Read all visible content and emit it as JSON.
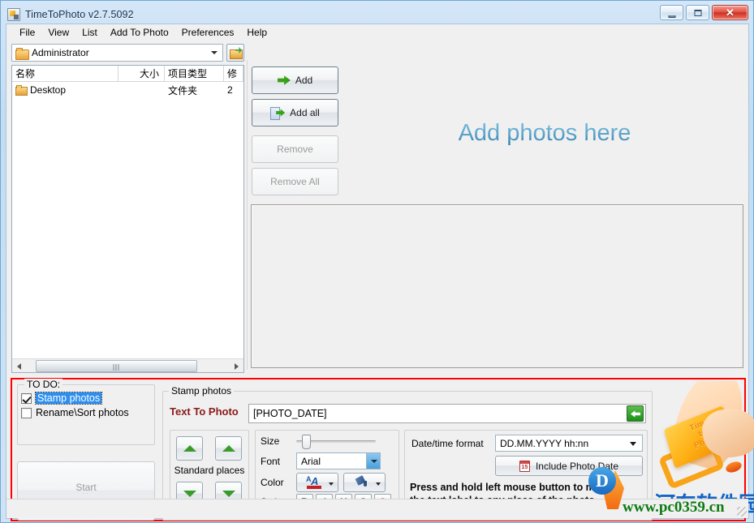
{
  "window": {
    "title": "TimeToPhoto v2.7.5092",
    "icon": "app-icon",
    "minimize_label": "",
    "maximize_label": "",
    "close_label": "✕"
  },
  "menu": {
    "items": [
      {
        "label": "File"
      },
      {
        "label": "View"
      },
      {
        "label": "List"
      },
      {
        "label": "Add To Photo"
      },
      {
        "label": "Preferences"
      },
      {
        "label": "Help"
      }
    ]
  },
  "browser": {
    "path_value": "Administrator",
    "browse_icon": "open-folder-icon",
    "dropdown_icon": "chevron-down-icon",
    "columns": [
      {
        "label": "名称"
      },
      {
        "label": "大小"
      },
      {
        "label": "项目类型"
      },
      {
        "label": "修"
      }
    ],
    "rows": [
      {
        "name": "Desktop",
        "size": "",
        "type": "文件夹",
        "extra": "2"
      }
    ],
    "scrollbar": {
      "left_icon": "arrow-left-icon",
      "right_icon": "arrow-right-icon"
    }
  },
  "actions": {
    "add": {
      "label": "Add",
      "icon": "green-arrow-right-icon",
      "enabled": true
    },
    "add_all": {
      "label": "Add all",
      "icon": "add-all-icon",
      "enabled": true
    },
    "remove": {
      "label": "Remove",
      "enabled": false
    },
    "remove_all": {
      "label": "Remove All",
      "enabled": false
    }
  },
  "drop_area": {
    "text": "Add photos here"
  },
  "todo": {
    "legend": "TO DO:",
    "items": [
      {
        "label": "Stamp photos",
        "checked": true,
        "selected": true
      },
      {
        "label": "Rename\\Sort photos",
        "checked": false,
        "selected": false
      }
    ],
    "start_button": {
      "label": "Start",
      "sub": "˙˙",
      "enabled": false
    }
  },
  "stamp": {
    "legend": "Stamp photos",
    "text_to_photo_label": "Text To Photo",
    "text_value": "[PHOTO_DATE]",
    "revert_icon": "green-arrow-left-icon",
    "places": {
      "label": "Standard places",
      "up_left_icon": "arrow-up-icon",
      "up_right_icon": "arrow-up-icon",
      "down_left_icon": "arrow-down-icon",
      "down_right_icon": "arrow-down-icon"
    },
    "format": {
      "size_label": "Size",
      "size_value": 12,
      "font_label": "Font",
      "font_value": "Arial",
      "color_label": "Color",
      "font_color_icon": "font-color-icon",
      "fill_color_icon": "fill-color-icon",
      "style_label": "Style",
      "style_buttons": [
        {
          "label": "B",
          "name": "bold"
        },
        {
          "label": "I",
          "name": "italic"
        },
        {
          "label": "U",
          "name": "underline"
        },
        {
          "label": "S",
          "name": "shadow"
        },
        {
          "label": "O",
          "name": "outline"
        }
      ]
    },
    "date": {
      "format_label": "Date/time format",
      "format_value": "DD.MM.YYYY hh:nn",
      "include_button": "Include Photo Date",
      "calendar_icon": "calendar-icon",
      "hint_line1": "Press and hold left mouse button to move",
      "hint_line2": "the text label to any place of the photo"
    }
  },
  "watermark": {
    "stamp_text_line1": "Time",
    "stamp_text_line2": "to",
    "stamp_text_line3": "Photo",
    "site_cn": "河东软件园",
    "site_url": "www.pc0359.cn",
    "logo_letter": "D"
  },
  "colors": {
    "accent_blue": "#2c8fef",
    "red_highlight": "#ff0000",
    "title_red": "#8b1a1a",
    "green": "#36a514"
  }
}
